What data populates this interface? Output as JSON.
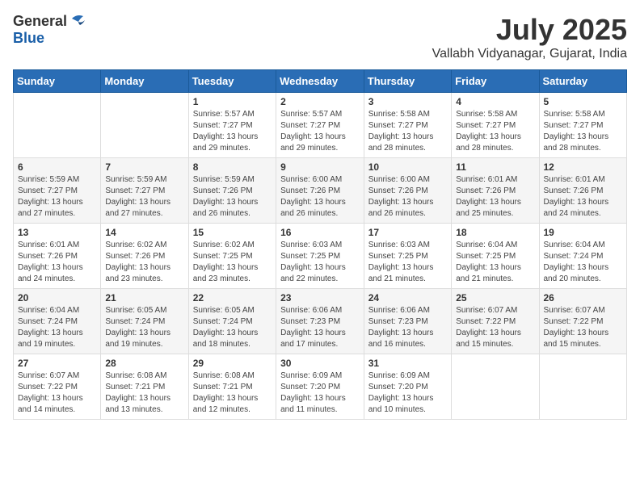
{
  "header": {
    "logo_general": "General",
    "logo_blue": "Blue",
    "month_year": "July 2025",
    "location": "Vallabh Vidyanagar, Gujarat, India"
  },
  "weekdays": [
    "Sunday",
    "Monday",
    "Tuesday",
    "Wednesday",
    "Thursday",
    "Friday",
    "Saturday"
  ],
  "weeks": [
    [
      {
        "day": "",
        "content": ""
      },
      {
        "day": "",
        "content": ""
      },
      {
        "day": "1",
        "content": "Sunrise: 5:57 AM\nSunset: 7:27 PM\nDaylight: 13 hours and 29 minutes."
      },
      {
        "day": "2",
        "content": "Sunrise: 5:57 AM\nSunset: 7:27 PM\nDaylight: 13 hours and 29 minutes."
      },
      {
        "day": "3",
        "content": "Sunrise: 5:58 AM\nSunset: 7:27 PM\nDaylight: 13 hours and 28 minutes."
      },
      {
        "day": "4",
        "content": "Sunrise: 5:58 AM\nSunset: 7:27 PM\nDaylight: 13 hours and 28 minutes."
      },
      {
        "day": "5",
        "content": "Sunrise: 5:58 AM\nSunset: 7:27 PM\nDaylight: 13 hours and 28 minutes."
      }
    ],
    [
      {
        "day": "6",
        "content": "Sunrise: 5:59 AM\nSunset: 7:27 PM\nDaylight: 13 hours and 27 minutes."
      },
      {
        "day": "7",
        "content": "Sunrise: 5:59 AM\nSunset: 7:27 PM\nDaylight: 13 hours and 27 minutes."
      },
      {
        "day": "8",
        "content": "Sunrise: 5:59 AM\nSunset: 7:26 PM\nDaylight: 13 hours and 26 minutes."
      },
      {
        "day": "9",
        "content": "Sunrise: 6:00 AM\nSunset: 7:26 PM\nDaylight: 13 hours and 26 minutes."
      },
      {
        "day": "10",
        "content": "Sunrise: 6:00 AM\nSunset: 7:26 PM\nDaylight: 13 hours and 26 minutes."
      },
      {
        "day": "11",
        "content": "Sunrise: 6:01 AM\nSunset: 7:26 PM\nDaylight: 13 hours and 25 minutes."
      },
      {
        "day": "12",
        "content": "Sunrise: 6:01 AM\nSunset: 7:26 PM\nDaylight: 13 hours and 24 minutes."
      }
    ],
    [
      {
        "day": "13",
        "content": "Sunrise: 6:01 AM\nSunset: 7:26 PM\nDaylight: 13 hours and 24 minutes."
      },
      {
        "day": "14",
        "content": "Sunrise: 6:02 AM\nSunset: 7:26 PM\nDaylight: 13 hours and 23 minutes."
      },
      {
        "day": "15",
        "content": "Sunrise: 6:02 AM\nSunset: 7:25 PM\nDaylight: 13 hours and 23 minutes."
      },
      {
        "day": "16",
        "content": "Sunrise: 6:03 AM\nSunset: 7:25 PM\nDaylight: 13 hours and 22 minutes."
      },
      {
        "day": "17",
        "content": "Sunrise: 6:03 AM\nSunset: 7:25 PM\nDaylight: 13 hours and 21 minutes."
      },
      {
        "day": "18",
        "content": "Sunrise: 6:04 AM\nSunset: 7:25 PM\nDaylight: 13 hours and 21 minutes."
      },
      {
        "day": "19",
        "content": "Sunrise: 6:04 AM\nSunset: 7:24 PM\nDaylight: 13 hours and 20 minutes."
      }
    ],
    [
      {
        "day": "20",
        "content": "Sunrise: 6:04 AM\nSunset: 7:24 PM\nDaylight: 13 hours and 19 minutes."
      },
      {
        "day": "21",
        "content": "Sunrise: 6:05 AM\nSunset: 7:24 PM\nDaylight: 13 hours and 19 minutes."
      },
      {
        "day": "22",
        "content": "Sunrise: 6:05 AM\nSunset: 7:24 PM\nDaylight: 13 hours and 18 minutes."
      },
      {
        "day": "23",
        "content": "Sunrise: 6:06 AM\nSunset: 7:23 PM\nDaylight: 13 hours and 17 minutes."
      },
      {
        "day": "24",
        "content": "Sunrise: 6:06 AM\nSunset: 7:23 PM\nDaylight: 13 hours and 16 minutes."
      },
      {
        "day": "25",
        "content": "Sunrise: 6:07 AM\nSunset: 7:22 PM\nDaylight: 13 hours and 15 minutes."
      },
      {
        "day": "26",
        "content": "Sunrise: 6:07 AM\nSunset: 7:22 PM\nDaylight: 13 hours and 15 minutes."
      }
    ],
    [
      {
        "day": "27",
        "content": "Sunrise: 6:07 AM\nSunset: 7:22 PM\nDaylight: 13 hours and 14 minutes."
      },
      {
        "day": "28",
        "content": "Sunrise: 6:08 AM\nSunset: 7:21 PM\nDaylight: 13 hours and 13 minutes."
      },
      {
        "day": "29",
        "content": "Sunrise: 6:08 AM\nSunset: 7:21 PM\nDaylight: 13 hours and 12 minutes."
      },
      {
        "day": "30",
        "content": "Sunrise: 6:09 AM\nSunset: 7:20 PM\nDaylight: 13 hours and 11 minutes."
      },
      {
        "day": "31",
        "content": "Sunrise: 6:09 AM\nSunset: 7:20 PM\nDaylight: 13 hours and 10 minutes."
      },
      {
        "day": "",
        "content": ""
      },
      {
        "day": "",
        "content": ""
      }
    ]
  ]
}
